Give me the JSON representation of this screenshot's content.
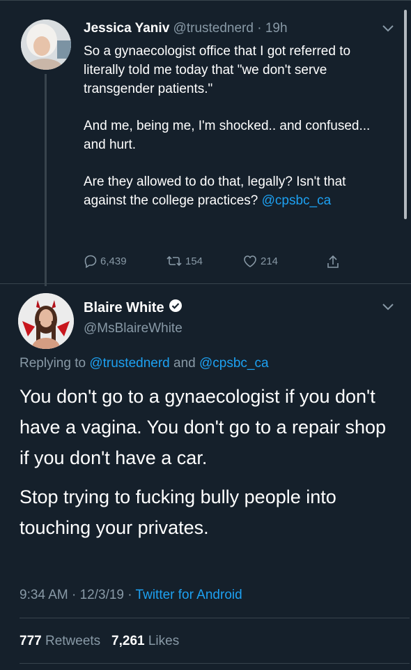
{
  "tweet1": {
    "display_name": "Jessica Yaniv",
    "handle": "@trustednerd",
    "time": "· 19h",
    "paragraphs": [
      "So a gynaecologist office that I got referred to literally told me today that \"we don't serve transgender patients.\"",
      "And me, being me, I'm shocked.. and confused... and hurt.",
      "Are they allowed to do that, legally? Isn't that against the college practices?"
    ],
    "mention": "@cpsbc_ca",
    "replies": "6,439",
    "retweets": "154",
    "likes": "214"
  },
  "tweet2": {
    "display_name": "Blaire White",
    "handle": "@MsBlaireWhite",
    "replying_prefix": "Replying to",
    "replying_to_1": "@trustednerd",
    "replying_and": "and",
    "replying_to_2": "@cpsbc_ca",
    "paragraphs": [
      "You don't go to a gynaecologist if you don't have a vagina. You don't go to a repair shop if you don't have a car.",
      "Stop trying to fucking bully people into touching your privates."
    ],
    "time": "9:34 AM",
    "date": "· 12/3/19 ·",
    "source": "Twitter for Android",
    "retweet_count": "777",
    "retweet_label": "Retweets",
    "like_count": "7,261",
    "like_label": "Likes"
  },
  "colors": {
    "background": "#15202b",
    "accent": "#1da1f2",
    "muted": "#8899a6",
    "divider": "#38444d"
  },
  "icons": [
    "chevron-down-icon",
    "reply-icon",
    "retweet-icon",
    "like-icon",
    "share-icon",
    "verified-badge-icon"
  ]
}
